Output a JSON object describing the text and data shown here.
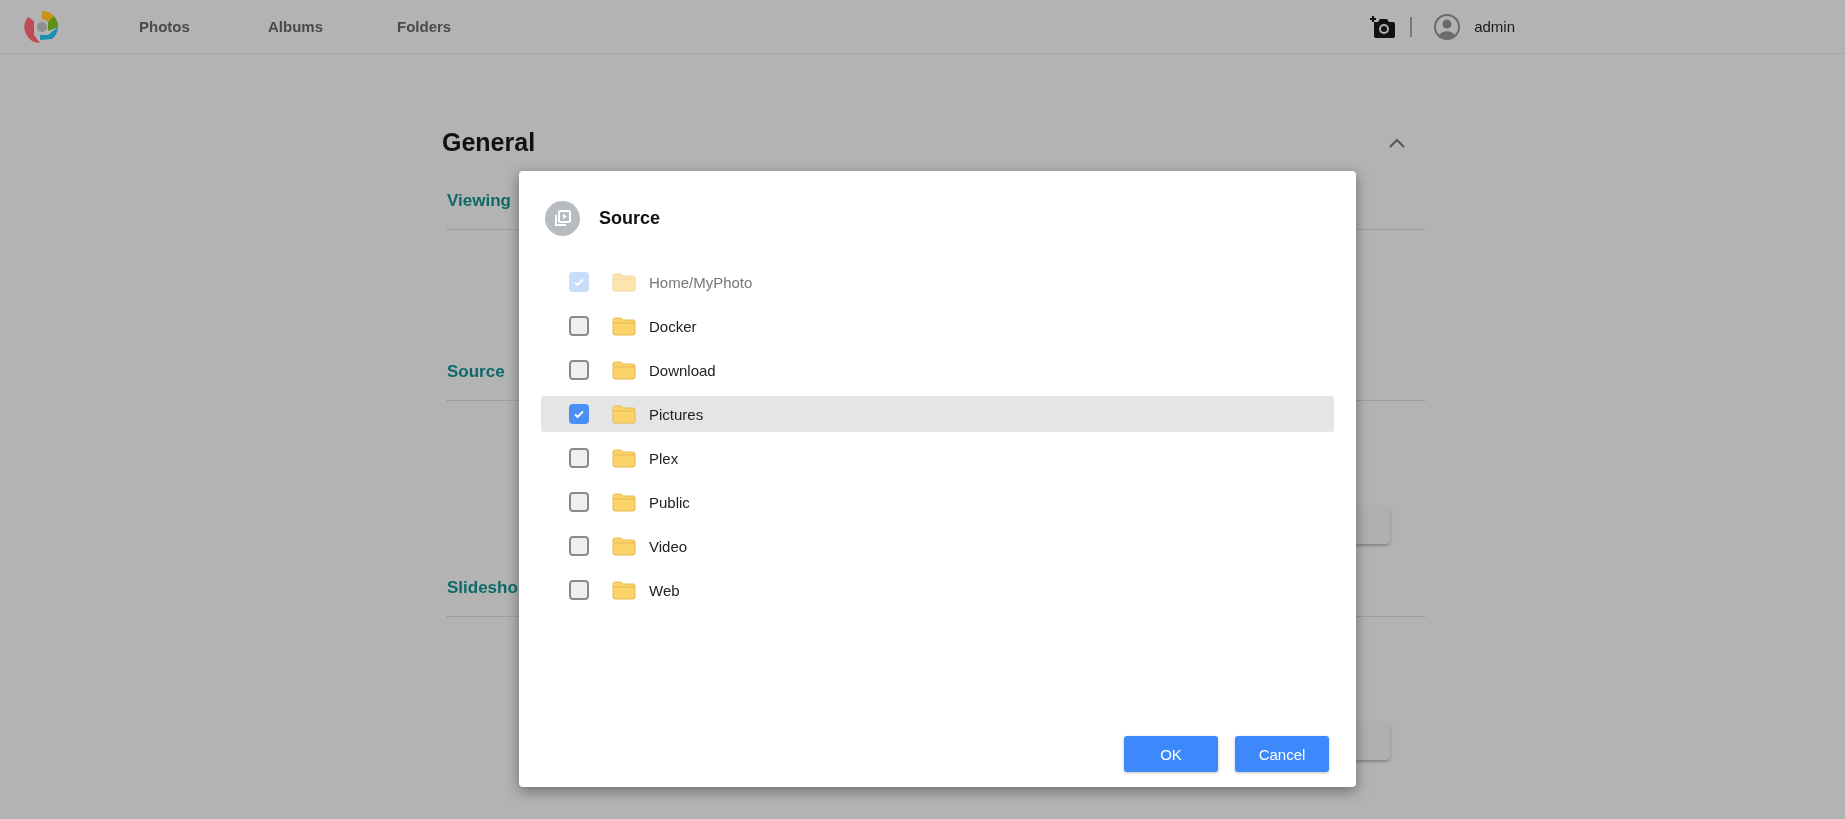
{
  "nav": {
    "items": [
      {
        "label": "Photos"
      },
      {
        "label": "Albums"
      },
      {
        "label": "Folders"
      }
    ]
  },
  "user": {
    "name": "admin"
  },
  "settings": {
    "title": "General",
    "expanded": true,
    "sections": [
      {
        "label": "Viewing",
        "has_button": false
      },
      {
        "label": "Source",
        "has_button": true
      },
      {
        "label": "Slidesho",
        "has_button": true
      }
    ]
  },
  "dialog": {
    "title": "Source",
    "folders": [
      {
        "name": "Home/MyPhoto",
        "checked": true,
        "disabled": true,
        "selected": false
      },
      {
        "name": "Docker",
        "checked": false,
        "disabled": false,
        "selected": false
      },
      {
        "name": "Download",
        "checked": false,
        "disabled": false,
        "selected": false
      },
      {
        "name": "Pictures",
        "checked": true,
        "disabled": false,
        "selected": true
      },
      {
        "name": "Plex",
        "checked": false,
        "disabled": false,
        "selected": false
      },
      {
        "name": "Public",
        "checked": false,
        "disabled": false,
        "selected": false
      },
      {
        "name": "Video",
        "checked": false,
        "disabled": false,
        "selected": false
      },
      {
        "name": "Web",
        "checked": false,
        "disabled": false,
        "selected": false
      }
    ],
    "buttons": [
      {
        "label": "OK"
      },
      {
        "label": "Cancel"
      }
    ]
  }
}
